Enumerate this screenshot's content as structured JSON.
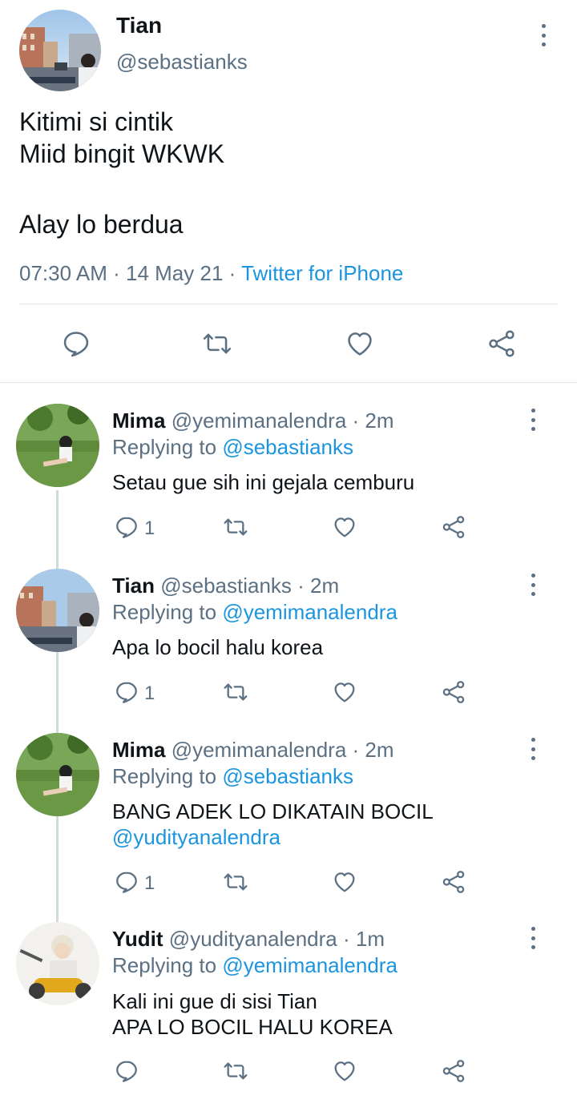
{
  "main_tweet": {
    "name": "Tian",
    "handle": "@sebastianks",
    "lines": [
      "Kitimi si cintik",
      "Miid bingit WKWK",
      "",
      "Alay lo berdua"
    ],
    "time": "07:30 AM",
    "date": "14 May 21",
    "source": "Twitter for iPhone",
    "sep": "·"
  },
  "replies": [
    {
      "name": "Mima",
      "handle": "@yemimanalendra",
      "age": "· 2m",
      "replying_label": "Replying to",
      "replying_to": "@sebastianks",
      "text_lines": [
        "Setau gue sih ini gejala cemburu"
      ],
      "mention": "",
      "reply_count": "1"
    },
    {
      "name": "Tian",
      "handle": "@sebastianks",
      "age": "· 2m",
      "replying_label": "Replying to",
      "replying_to": "@yemimanalendra",
      "text_lines": [
        "Apa lo bocil halu korea"
      ],
      "mention": "",
      "reply_count": "1"
    },
    {
      "name": "Mima",
      "handle": "@yemimanalendra",
      "age": "· 2m",
      "replying_label": "Replying to",
      "replying_to": "@sebastianks",
      "text_lines": [
        "BANG ADEK LO DIKATAIN BOCIL"
      ],
      "mention": "@yudityanalendra",
      "reply_count": "1"
    },
    {
      "name": "Yudit",
      "handle": "@yudityanalendra",
      "age": "· 1m",
      "replying_label": "Replying to",
      "replying_to": "@yemimanalendra",
      "text_lines": [
        "Kali ini gue di sisi Tian",
        "APA LO BOCIL HALU KOREA"
      ],
      "mention": "",
      "reply_count": ""
    }
  ],
  "colors": {
    "link": "#1b95e0",
    "muted": "#5b7083",
    "divider": "#e1e8ed"
  },
  "icons": [
    "reply-icon",
    "retweet-icon",
    "like-icon",
    "share-icon",
    "more-icon"
  ]
}
